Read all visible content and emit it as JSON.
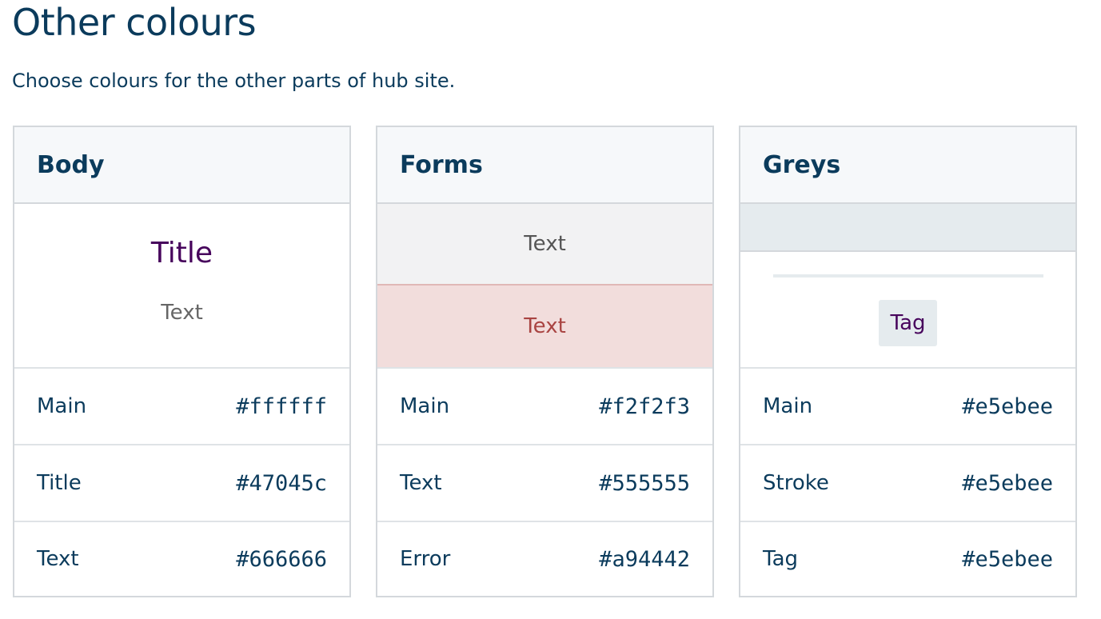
{
  "page": {
    "title": "Other colours",
    "subtitle": "Choose colours for the other parts of hub site."
  },
  "cards": {
    "body": {
      "title": "Body",
      "preview": {
        "title_sample": "Title",
        "text_sample": "Text"
      },
      "rows": [
        {
          "label": "Main",
          "value": "#ffffff"
        },
        {
          "label": "Title",
          "value": "#47045c"
        },
        {
          "label": "Text",
          "value": "#666666"
        }
      ]
    },
    "forms": {
      "title": "Forms",
      "preview": {
        "field_text": "Text",
        "error_text": "Text"
      },
      "rows": [
        {
          "label": "Main",
          "value": "#f2f2f3"
        },
        {
          "label": "Text",
          "value": "#555555"
        },
        {
          "label": "Error",
          "value": "#a94442"
        }
      ]
    },
    "greys": {
      "title": "Greys",
      "preview": {
        "tag_text": "Tag"
      },
      "rows": [
        {
          "label": "Main",
          "value": "#e5ebee"
        },
        {
          "label": "Stroke",
          "value": "#e5ebee"
        },
        {
          "label": "Tag",
          "value": "#e5ebee"
        }
      ]
    }
  },
  "colors": {
    "heading": "#0b3b5c",
    "border": "#d4d8dc",
    "header_bg": "#f6f8fa"
  }
}
